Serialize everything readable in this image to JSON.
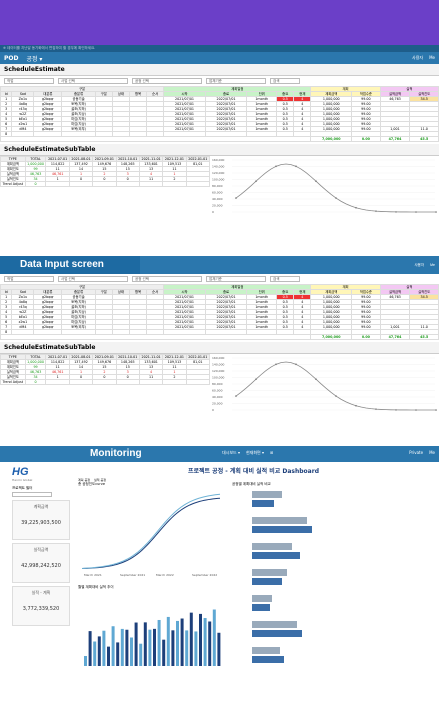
{
  "screen1": {
    "topnote": "※ 데이터를 지난달 동기화에서 편집하여 할 경우에 확인하세요.",
    "nav_brand": "POD",
    "nav_menu": "공정 ▾",
    "nav_right": [
      "사용자",
      "Me"
    ],
    "section_title": "ScheduleEstimate",
    "filters": [
      "작업",
      "사업 선택",
      "공정 선택",
      "업체기준",
      "검색"
    ],
    "group_headers": [
      "구분",
      "계획일정",
      "계획",
      "실적"
    ],
    "headers": [
      "Id",
      "Sod",
      "대분류",
      "중분류",
      "구분",
      "상태",
      "항목",
      "순서",
      "시작",
      "종료",
      "단위",
      "중요",
      "현재",
      "계획금액",
      "작업수준",
      "실적금액",
      "실적진도"
    ],
    "rows": [
      [
        "1",
        "Za1u",
        "g2bqqr",
        "공동기술",
        "",
        "",
        "",
        "",
        "2021/07/01",
        "2022/07/01",
        "1month",
        "0.5",
        "4",
        "1,000,000",
        "99.00",
        "46,763",
        "34.5"
      ],
      [
        "2",
        "4a8q",
        "g2bqqr",
        "토목(지하)",
        "",
        "",
        "",
        "",
        "2021/07/01",
        "2022/07/01",
        "1month",
        "0.5",
        "4",
        "1,000,000",
        "99.00",
        "",
        ""
      ],
      [
        "3",
        "r43q",
        "g2bqqr",
        "골조(지하)",
        "",
        "",
        "",
        "",
        "2021/07/01",
        "2022/07/01",
        "1month",
        "0.5",
        "4",
        "1,000,000",
        "99.00",
        "",
        ""
      ],
      [
        "4",
        "w2Z",
        "g2bqqr",
        "골조(지상)",
        "",
        "",
        "",
        "",
        "2021/07/01",
        "2022/07/01",
        "1month",
        "0.5",
        "4",
        "1,000,000",
        "99.00",
        "",
        ""
      ],
      [
        "5",
        "bEa1",
        "g2bqqr",
        "마감(지하)",
        "",
        "",
        "",
        "",
        "2021/07/01",
        "2022/07/01",
        "1month",
        "0.5",
        "4",
        "1,000,000",
        "99.00",
        "",
        ""
      ],
      [
        "6",
        "z2w1",
        "g2bqqr",
        "마감(지상)",
        "",
        "",
        "",
        "",
        "2021/07/01",
        "2022/07/01",
        "1month",
        "0.5",
        "4",
        "1,000,000",
        "99.00",
        "",
        ""
      ],
      [
        "7",
        "dM4",
        "g2bqqr",
        "토목(외부)",
        "",
        "",
        "",
        "",
        "2021/07/01",
        "2022/07/01",
        "1month",
        "0.5",
        "4",
        "1,000,000",
        "99.00",
        "1,001",
        "11.0"
      ],
      [
        "8",
        "",
        "",
        "",
        "",
        "",
        "",
        "",
        "",
        "",
        "",
        "",
        "",
        "",
        "",
        "",
        ""
      ]
    ],
    "sum_row": [
      "7,000,000",
      "0.00",
      "47,764",
      "45.5"
    ],
    "sub_title": "ScheduleEstimateSubTable",
    "sub_headers": [
      "TYPE",
      "TOTAL",
      "2021-07-01",
      "2021-08-01",
      "2021-09-01",
      "2021-10-01",
      "2021-11-01",
      "2021-12-01",
      "2022-01-01"
    ],
    "sub_rows": [
      [
        "계획금액",
        "1,000,000",
        "114,822",
        "137,492",
        "149,676",
        "148,265",
        "133,601",
        "109,513",
        "81,01"
      ],
      [
        "계획진도",
        "99",
        "11",
        "14",
        "15",
        "15",
        "13",
        "11",
        ""
      ],
      [
        "실적금액",
        "46,763",
        "46,761",
        "1",
        "2",
        "3",
        "4",
        "1",
        ""
      ],
      [
        "실적진도",
        "34",
        "1",
        "0",
        "0",
        "0",
        "11",
        "2",
        ""
      ],
      [
        "Trend Adjust",
        "0",
        "",
        "",
        "",
        "",
        "",
        "",
        ""
      ]
    ],
    "chart_yticks": [
      "160,000",
      "140,000",
      "120,000",
      "100,000",
      "80,000",
      "60,000",
      "40,000",
      "20,000",
      "0"
    ]
  },
  "screen2": {
    "label": "Data Input screen",
    "nav_right": [
      "사용자",
      "Me"
    ]
  },
  "screen3": {
    "label": "Monitoring",
    "menu": [
      "대시보드 ▾",
      "현재화면 ▾",
      "⊞"
    ],
    "nav_right": [
      "Private",
      "Me"
    ],
    "logo": "HG",
    "logo_sub": "Hanmi Global",
    "dashboard_title": "프로젝트 공정 - 계획 대비 실적 비교 Dashboard",
    "filter_label": "프로젝트 필터",
    "legend": [
      "계획 공정",
      "실적 공정"
    ],
    "kpis": [
      {
        "label": "계획금액",
        "value": "39,225,903,500"
      },
      {
        "label": "실적금액",
        "value": "42,998,242,520"
      },
      {
        "label": "실적 - 계획",
        "value": "3,772,339,520"
      }
    ],
    "s_curve_title": "총 공정진도curve",
    "monthly_title": "월별 계획대비 실적 추이",
    "hbar_title": "공정별 계획대비 실적 비교",
    "xlabels": [
      "March 2021",
      "September 2021",
      "March 2022",
      "September 2022"
    ]
  }
}
